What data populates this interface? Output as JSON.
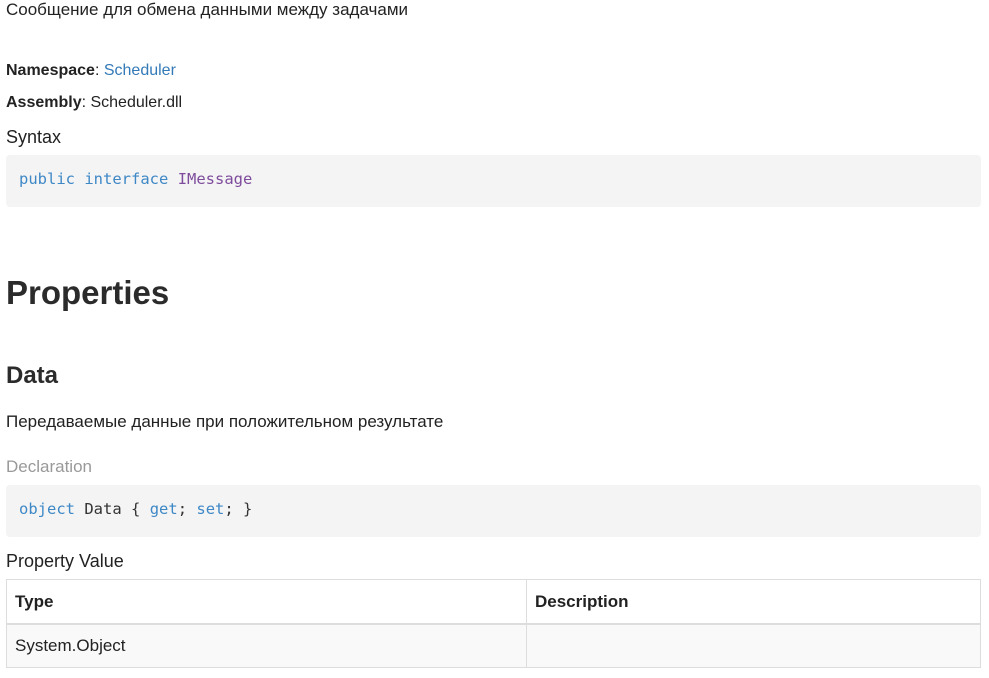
{
  "summary": "Сообщение для обмена данными между задачами",
  "namespace": {
    "label": "Namespace",
    "value": "Scheduler"
  },
  "assembly": {
    "label": "Assembly",
    "value": "Scheduler.dll"
  },
  "syntax": {
    "heading": "Syntax",
    "code": {
      "kw1": "public",
      "kw2": "interface",
      "type": "IMessage"
    }
  },
  "properties_heading": "Properties",
  "property": {
    "name": "Data",
    "summary": "Передаваемые данные при положительном результате",
    "declaration_heading": "Declaration",
    "code": {
      "kw_object": "object",
      "name": "Data",
      "open": "{",
      "kw_get": "get",
      "kw_set": "set",
      "close": "}"
    },
    "value_heading": "Property Value",
    "table": {
      "headers": [
        "Type",
        "Description"
      ],
      "rows": [
        [
          "System.Object",
          ""
        ]
      ]
    }
  }
}
